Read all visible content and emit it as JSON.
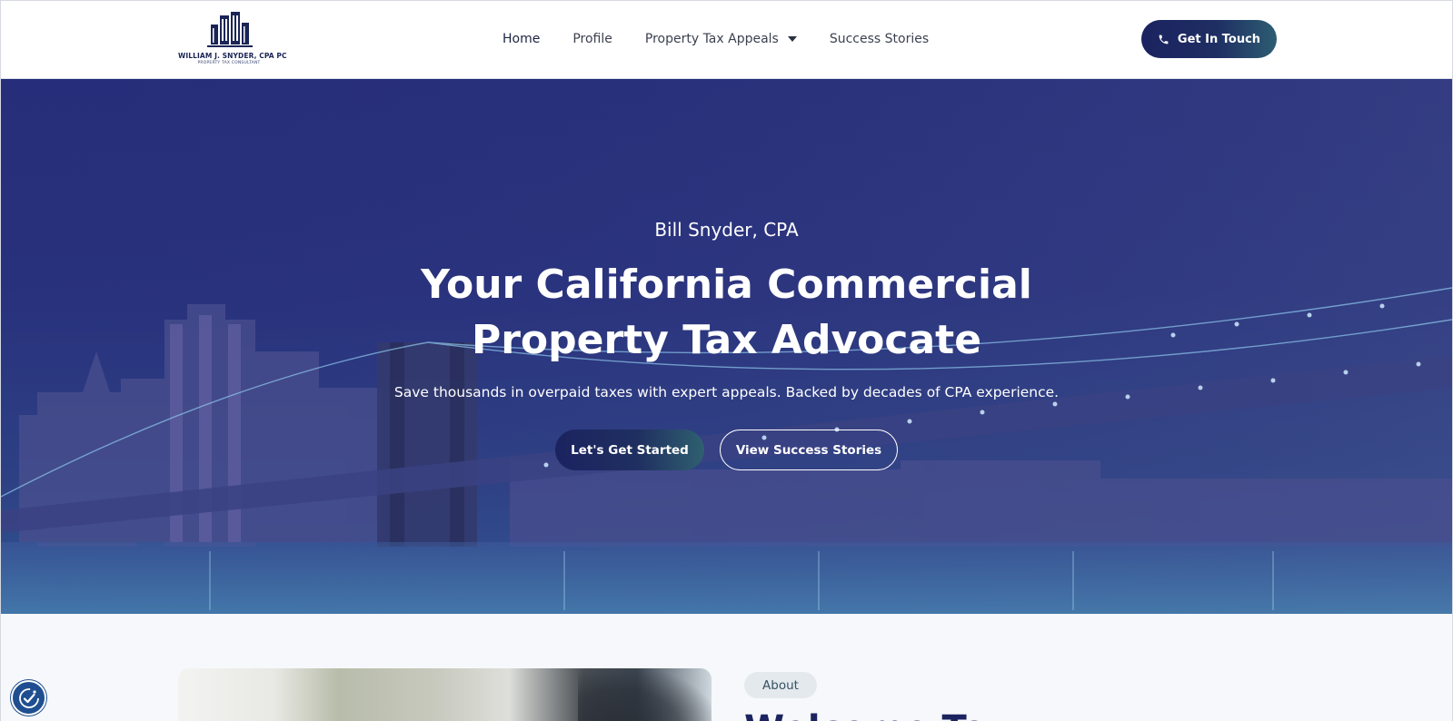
{
  "header": {
    "logo": {
      "name": "WILLIAM J. SNYDER, CPA PC",
      "tagline": "PROPERTY TAX CONSULTANT"
    },
    "nav": [
      {
        "label": "Home"
      },
      {
        "label": "Profile"
      },
      {
        "label": "Property Tax Appeals"
      },
      {
        "label": "Success Stories"
      }
    ],
    "cta": {
      "label": "Get In Touch",
      "icon": "phone-icon"
    }
  },
  "hero": {
    "kicker": "Bill Snyder, CPA",
    "title_line1": "Your California Commercial",
    "title_line2": "Property Tax Advocate",
    "subtitle": "Save thousands in overpaid taxes with expert appeals. Backed by decades of CPA experience.",
    "primary_button": "Let's Get Started",
    "secondary_button": "View Success Stories"
  },
  "about": {
    "pill": "About",
    "heading": "Welcome To"
  },
  "colors": {
    "brand_navy": "#1b2360",
    "brand_teal": "#2f6070",
    "hero_overlay": "#262c78",
    "accessibility_blue": "#1f4f90"
  }
}
